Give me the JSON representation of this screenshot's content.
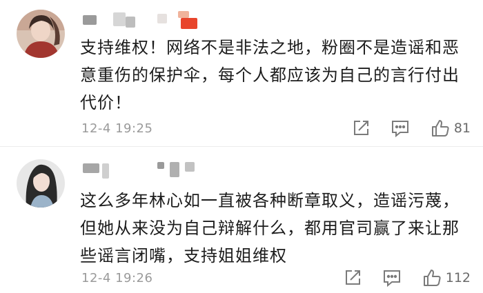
{
  "comments": [
    {
      "text_lines": [
        "支持维权！网络不是非法之地，粉圈不是造谣和恶",
        "意重伤的保护伞，每个人都应该为自己的言行付出",
        "代价！"
      ],
      "time": "12-4 19:25",
      "likes": "81",
      "icons": {
        "share": "share-icon",
        "comment": "comment-icon",
        "like": "thumbs-up-icon"
      }
    },
    {
      "text_lines": [
        "这么多年林心如一直被各种断章取义，造谣污蔑，",
        "但她从来没为自己辩解什么，都用官司赢了来让那",
        "些谣言闭嘴，支持姐姐维权"
      ],
      "time": "12-4 19:26",
      "likes": "112",
      "icons": {
        "share": "share-icon",
        "comment": "comment-icon",
        "like": "thumbs-up-icon"
      }
    }
  ],
  "colors": {
    "text": "#1c1c1c",
    "meta": "#9a9a9a",
    "icon": "#7a7a7a",
    "name_accent": "#e8452c"
  }
}
